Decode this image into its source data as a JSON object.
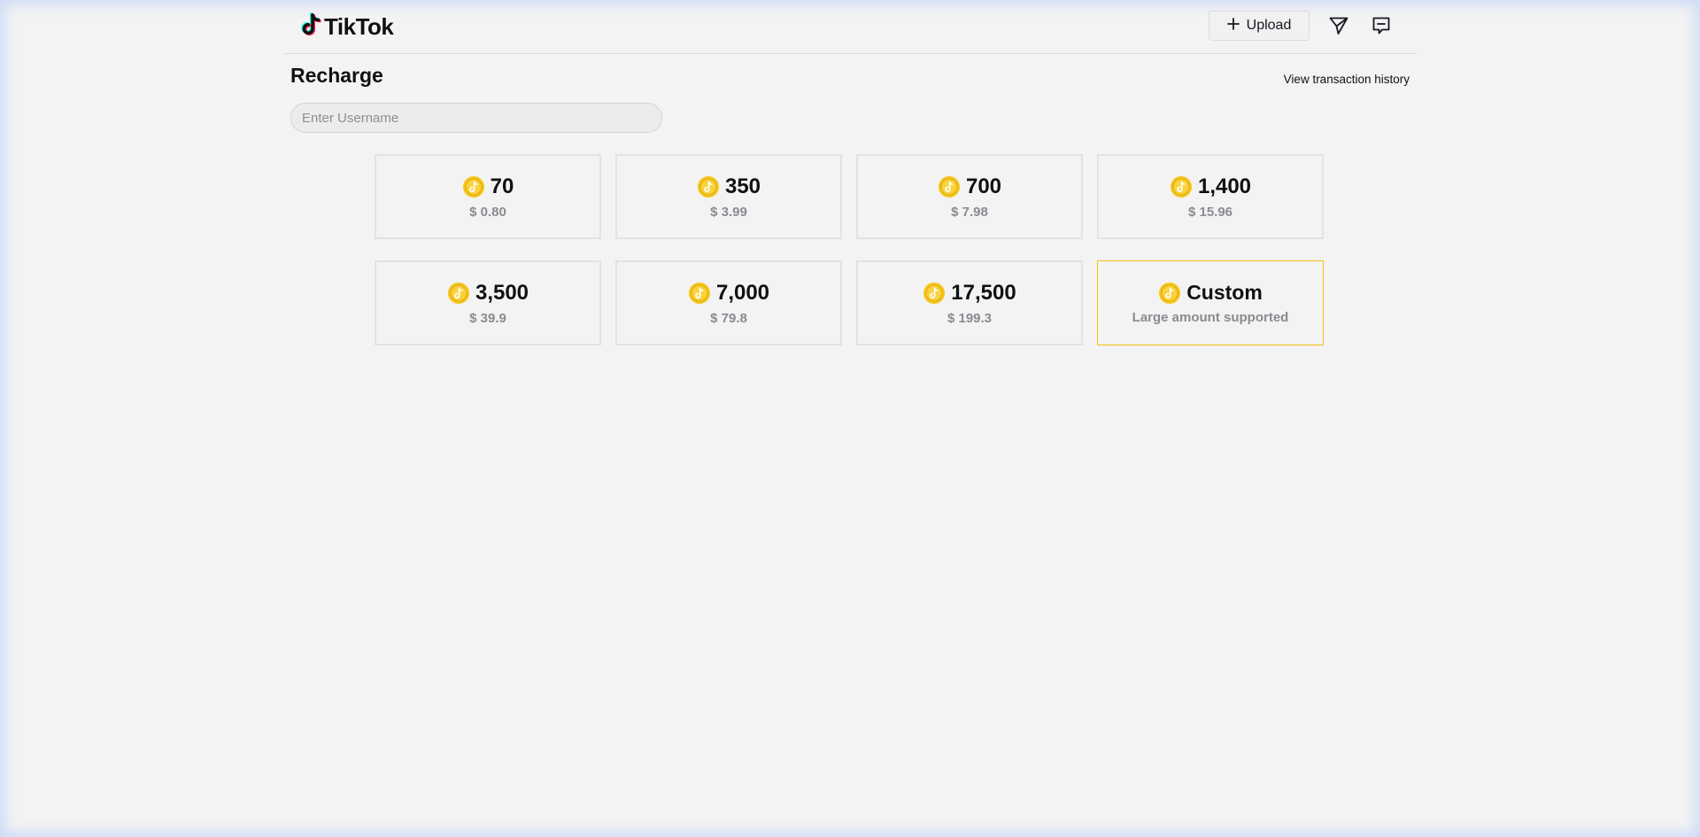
{
  "header": {
    "logo_text": "TikTok",
    "upload_label": "Upload"
  },
  "page": {
    "title": "Recharge",
    "history_link": "View transaction history"
  },
  "username": {
    "placeholder": "Enter Username",
    "value": ""
  },
  "packages": [
    {
      "amount": "70",
      "price": "$ 0.80"
    },
    {
      "amount": "350",
      "price": "$ 3.99"
    },
    {
      "amount": "700",
      "price": "$ 7.98"
    },
    {
      "amount": "1,400",
      "price": "$ 15.96"
    },
    {
      "amount": "3,500",
      "price": "$ 39.9"
    },
    {
      "amount": "7,000",
      "price": "$ 79.8"
    },
    {
      "amount": "17,500",
      "price": "$ 199.3"
    }
  ],
  "custom": {
    "label": "Custom",
    "subtitle": "Large amount supported"
  },
  "colors": {
    "coin": "#f5c518",
    "custom_border": "#f2c311",
    "price_text": "#8a8b91",
    "background": "#f3f3f3"
  },
  "icons": {
    "logo": "tiktok-note-icon",
    "upload": "plus-icon",
    "send": "paper-plane-icon",
    "inbox": "message-icon",
    "coin": "coin-icon"
  }
}
